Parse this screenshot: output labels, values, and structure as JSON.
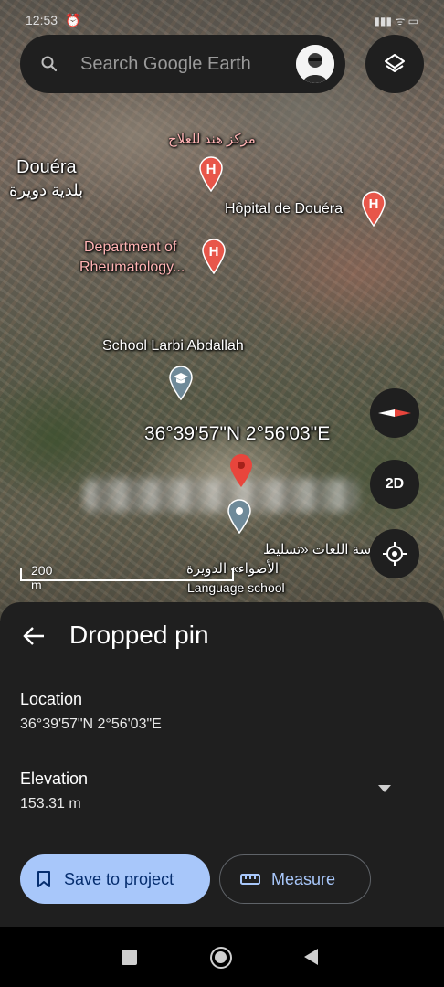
{
  "status_bar": {
    "time": "12:53",
    "right": "▮▮▮ ᯤ ▭"
  },
  "search": {
    "placeholder": "Search Google Earth"
  },
  "map": {
    "labels": {
      "douera": "Douéra",
      "douera_ar": "بلدية دويرة",
      "hind_ar": "مركز هند للعلاج",
      "hopital": "Hôpital de Douéra",
      "dept_line1": "Department of",
      "dept_line2": "Rheumatology...",
      "school": "School Larbi Abdallah",
      "coords": "36°39'57\"N 2°56'03\"E",
      "lang_ar_line1": "مدرسة اللغات «تسليط",
      "lang_ar_line2": "الأضواء» الدويرة",
      "lang_en": "Language school"
    },
    "scale": "200 m",
    "view_mode_label": "2D"
  },
  "sheet": {
    "title": "Dropped pin",
    "location_label": "Location",
    "location_value": "36°39'57\"N 2°56'03\"E",
    "elevation_label": "Elevation",
    "elevation_value": "153.31 m",
    "save_label": "Save to project",
    "measure_label": "Measure"
  },
  "colors": {
    "sheet_bg": "#1f1f1f",
    "primary_button": "#a8c7fa",
    "pin_red": "#e8453c",
    "hospital_pin": "#e8564a"
  },
  "icons": [
    "search-icon",
    "avatar",
    "layers-icon",
    "hospital-icon",
    "school-icon",
    "red-pin-icon",
    "place-pin-icon",
    "compass-icon",
    "locate-icon",
    "back-arrow-icon",
    "chevron-down-icon",
    "bookmark-icon",
    "ruler-icon"
  ]
}
